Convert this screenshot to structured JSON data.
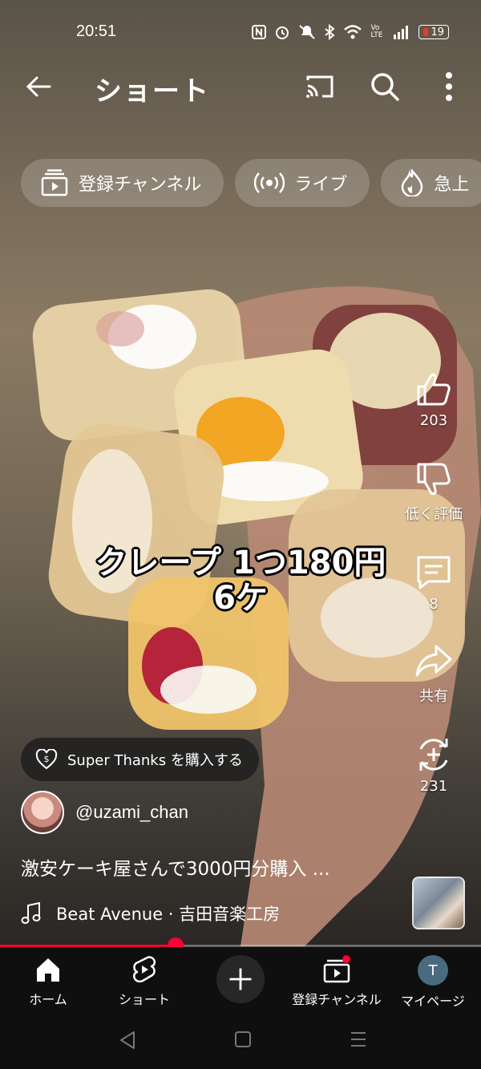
{
  "status_bar": {
    "time": "20:51",
    "battery": "19",
    "icons": [
      "nfc-icon",
      "alarm-icon",
      "mute-icon",
      "bluetooth-icon",
      "wifi-icon",
      "volte-icon",
      "signal-icon",
      "battery-icon"
    ],
    "volte_text": "Vo LTE"
  },
  "top_bar": {
    "title": "ショート"
  },
  "chips": [
    {
      "label": "登録チャンネル",
      "icon": "subscriptions-icon"
    },
    {
      "label": "ライブ",
      "icon": "live-icon"
    },
    {
      "label": "急上",
      "icon": "trending-icon"
    }
  ],
  "video": {
    "overlay_line1": "クレープ 1つ180円",
    "overlay_line2": "6ケ"
  },
  "actions": {
    "like_count": "203",
    "dislike_label": "低く評価",
    "comment_count": "8",
    "share_label": "共有",
    "remix_count": "231"
  },
  "super_thanks": {
    "label": "Super Thanks を購入する"
  },
  "channel": {
    "handle": "@uzami_chan"
  },
  "description": "激安ケーキ屋さんで3000円分購入 ...",
  "music": {
    "label": "Beat Avenue · 吉田音楽工房"
  },
  "progress": {
    "fraction": 0.365
  },
  "bottom_nav": {
    "home": "ホーム",
    "shorts": "ショート",
    "subscriptions": "登録チャンネル",
    "you": "マイページ",
    "avatar_initial": "T"
  },
  "colors": {
    "accent": "#ff0033",
    "nav_bg": "#0f0f0f"
  }
}
